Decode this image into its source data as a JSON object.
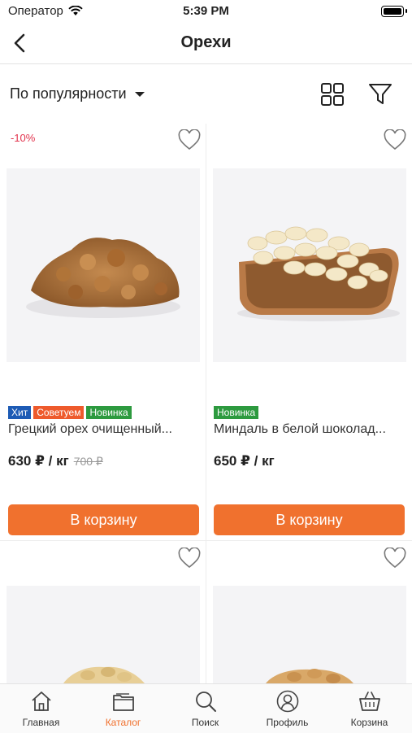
{
  "status": {
    "carrier": "Оператор",
    "time": "5:39 PM"
  },
  "nav": {
    "title": "Орехи"
  },
  "toolbar": {
    "sort_label": "По популярности"
  },
  "products": [
    {
      "discount": "-10%",
      "badges": [
        {
          "text": "Хит",
          "type": "hit"
        },
        {
          "text": "Советуем",
          "type": "rec"
        },
        {
          "text": "Новинка",
          "type": "new"
        }
      ],
      "name": "Грецкий орех очищенный...",
      "price": "630 ₽ / кг",
      "old_price": "700 ₽",
      "button": "В корзину"
    },
    {
      "discount": "",
      "badges": [
        {
          "text": "Новинка",
          "type": "new"
        }
      ],
      "name": "Миндаль в белой шоколад...",
      "price": "650 ₽ / кг",
      "old_price": "",
      "button": "В корзину"
    }
  ],
  "tabs": [
    {
      "label": "Главная",
      "icon": "home-icon",
      "active": false
    },
    {
      "label": "Каталог",
      "icon": "catalog-icon",
      "active": true
    },
    {
      "label": "Поиск",
      "icon": "search-icon",
      "active": false
    },
    {
      "label": "Профиль",
      "icon": "profile-icon",
      "active": false
    },
    {
      "label": "Корзина",
      "icon": "basket-icon",
      "active": false
    }
  ],
  "colors": {
    "accent": "#f0712e",
    "discount": "#e2344e",
    "badge_hit": "#1d5bb5",
    "badge_rec": "#ee5a2c",
    "badge_new": "#2d9a3f"
  }
}
